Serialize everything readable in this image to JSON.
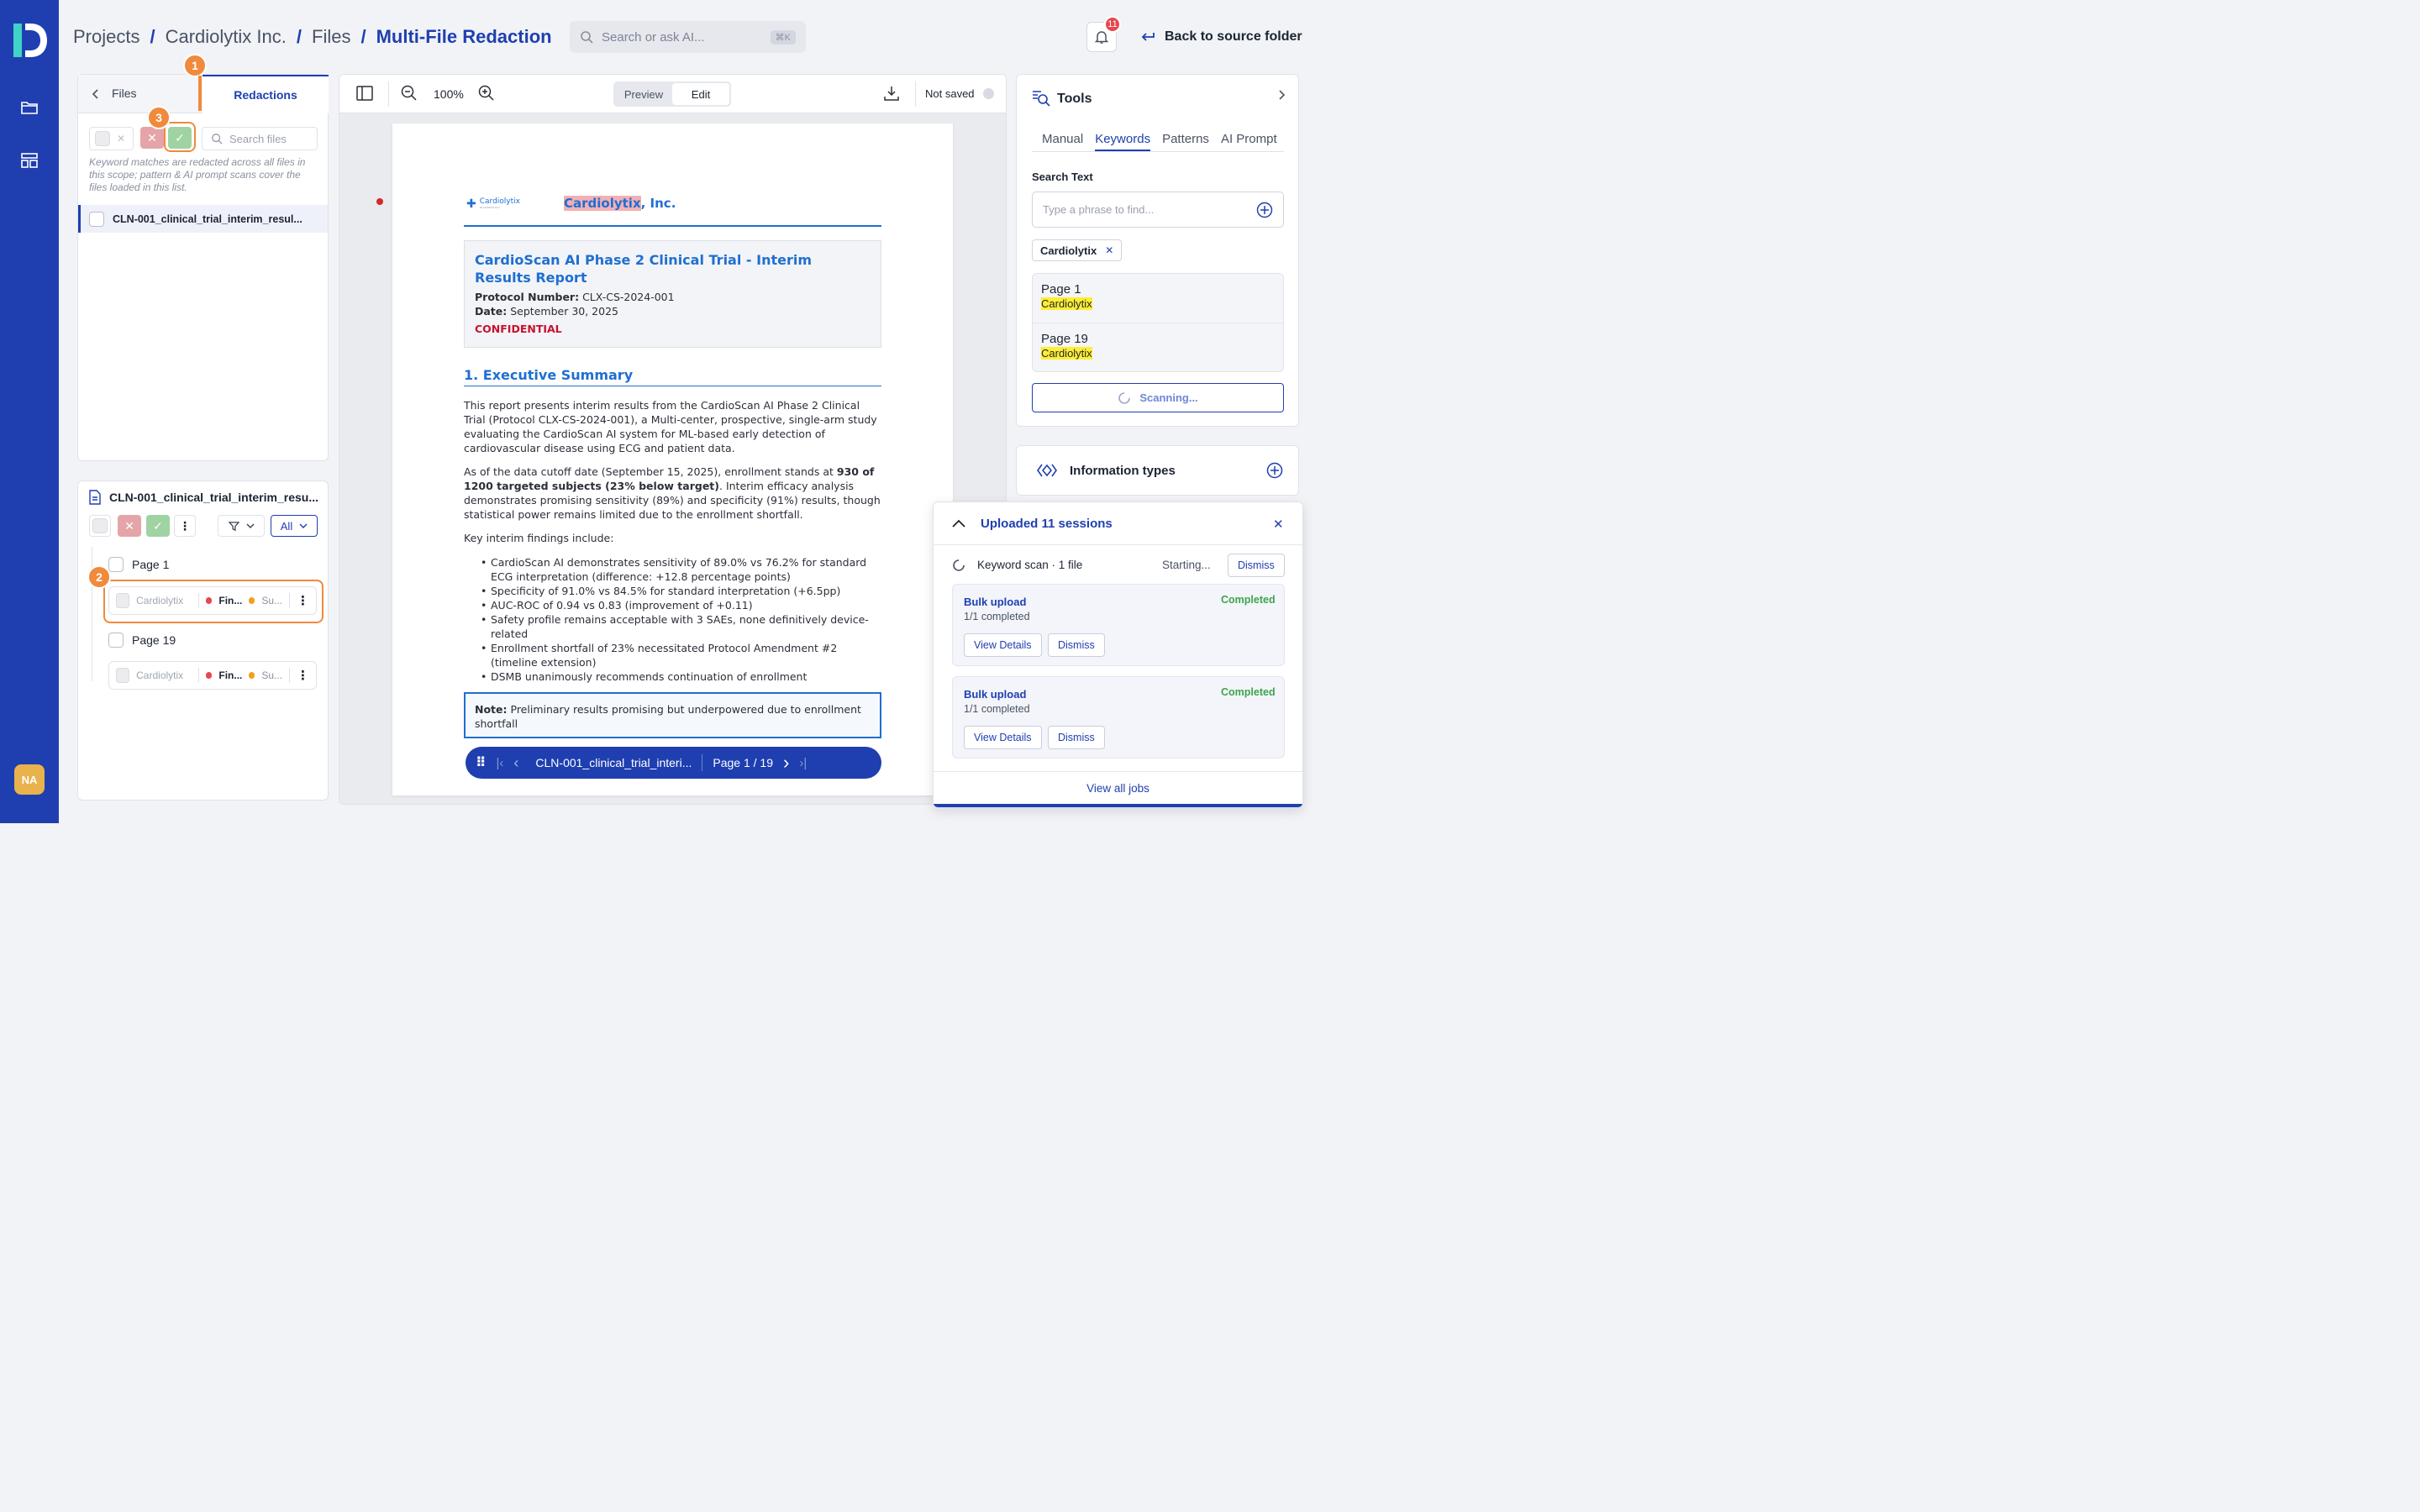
{
  "user": {
    "initials": "NA"
  },
  "breadcrumb": {
    "items": [
      "Projects",
      "Cardiolytix Inc.",
      "Files"
    ],
    "current": "Multi-File Redaction"
  },
  "search": {
    "placeholder": "Search or ask AI...",
    "shortcut": "⌘K"
  },
  "notifications": {
    "count": "11"
  },
  "header": {
    "back_label": "Back to source folder"
  },
  "left_panel": {
    "tabs": [
      "Files",
      "Redactions"
    ],
    "file_search_placeholder": "Search files",
    "note": "Keyword matches are redacted across all files in this scope; pattern & AI prompt scans cover the files loaded in this list.",
    "files": [
      "CLN-001_clinical_trial_interim_resul..."
    ],
    "markers": [
      "1",
      "2",
      "3"
    ]
  },
  "redaction_panel": {
    "file_name": "CLN-001_clinical_trial_interim_resu...",
    "filter_value": "All",
    "pages": [
      {
        "label": "Page 1",
        "item": {
          "text": "Cardiolytix",
          "tag1": "Fin...",
          "tag2": "Su..."
        }
      },
      {
        "label": "Page 19",
        "item": {
          "text": "Cardiolytix",
          "tag1": "Fin...",
          "tag2": "Su..."
        }
      }
    ]
  },
  "viewer": {
    "zoom": "100%",
    "modes": [
      "Preview",
      "Edit"
    ],
    "active_mode": "Edit",
    "save_status": "Not saved",
    "doc": {
      "logo_text": "Cardiolytix",
      "logo_sub": "DIAGNOSTICS",
      "company_hl": "Cardiolytix",
      "company_rest": ", Inc.",
      "title": "CardioScan AI Phase 2 Clinical Trial - Interim Results Report",
      "protocol_label": "Protocol Number:",
      "protocol_value": "CLX-CS-2024-001",
      "date_label": "Date:",
      "date_value": "September 30, 2025",
      "confidential": "CONFIDENTIAL",
      "section": "1. Executive Summary",
      "p1": "This report presents interim results from the CardioScan AI Phase 2 Clinical Trial (Protocol CLX-CS-2024-001), a Multi-center, prospective, single-arm study evaluating the CardioScan AI system for ML-based early detection of cardiovascular disease using ECG and patient data.",
      "p2_a": "As of the data cutoff date (September 15, 2025), enrollment stands at ",
      "p2_b": "930 of 1200 targeted subjects (23% below target)",
      "p2_c": ". Interim efficacy analysis demonstrates promising sensitivity (89%) and specificity (91%) results, though statistical power remains limited due to the enrollment shortfall.",
      "p3": "Key interim findings include:",
      "bullets": [
        "CardioScan AI demonstrates sensitivity of 89.0% vs 76.2% for standard ECG interpretation (difference: +12.8 percentage points)",
        "Specificity of 91.0% vs 84.5% for standard interpretation (+6.5pp)",
        "AUC-ROC of 0.94 vs 0.83 (improvement of +0.11)",
        "Safety profile remains acceptable with 3 SAEs, none definitively device-related",
        "Enrollment shortfall of 23% necessitated Protocol Amendment #2 (timeline extension)",
        "DSMB unanimously recommends continuation of enrollment"
      ],
      "note_label": "Note:",
      "note_text": "Preliminary results promising but underpowered due to enrollment shortfall"
    },
    "nav": {
      "file": "CLN-001_clinical_trial_interi...",
      "page": "Page 1 / 19"
    }
  },
  "tools": {
    "title": "Tools",
    "tabs": [
      "Manual",
      "Keywords",
      "Patterns",
      "AI Prompt"
    ],
    "active_tab": "Keywords",
    "search_label": "Search Text",
    "search_placeholder": "Type a phrase to find...",
    "chip": "Cardiolytix",
    "results": [
      {
        "page": "Page 1",
        "match": "Cardiolytix"
      },
      {
        "page": "Page 19",
        "match": "Cardiolytix"
      }
    ],
    "scanning": "Scanning..."
  },
  "info_types": {
    "title": "Information types"
  },
  "jobs": {
    "title": "Uploaded 11 sessions",
    "scan_label": "Keyword scan · 1 file",
    "scan_status": "Starting...",
    "dismiss": "Dismiss",
    "cards": [
      {
        "title": "Bulk upload",
        "sub": "1/1 completed",
        "status": "Completed",
        "view": "View Details",
        "dismiss": "Dismiss"
      },
      {
        "title": "Bulk upload",
        "sub": "1/1 completed",
        "status": "Completed",
        "view": "View Details",
        "dismiss": "Dismiss"
      }
    ],
    "view_all": "View all jobs"
  },
  "colors": {
    "brand": "#1f3fb0",
    "marker": "#f08a3c",
    "success": "#3fa34d",
    "danger": "#e5484d"
  }
}
